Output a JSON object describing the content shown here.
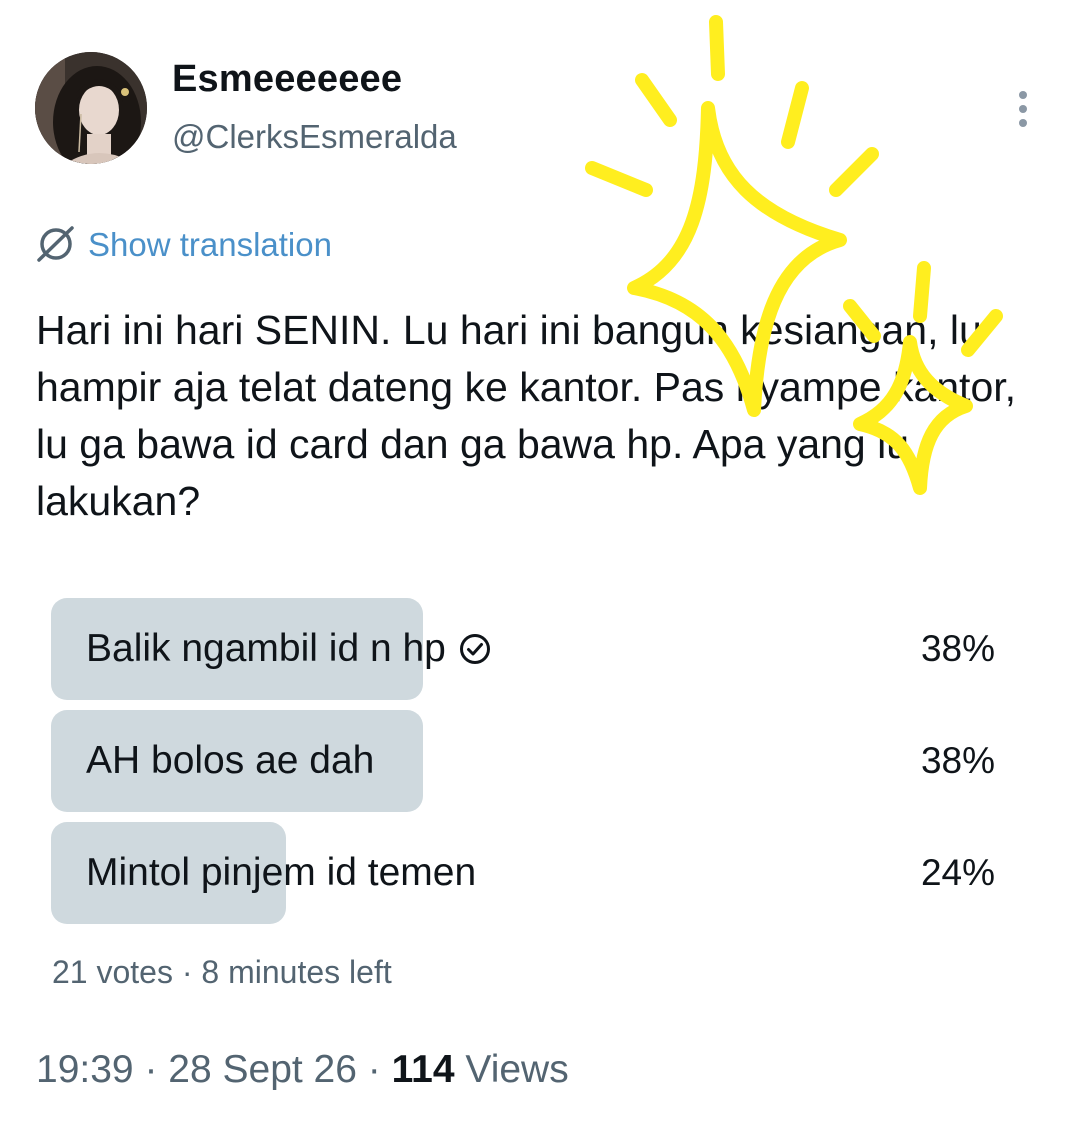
{
  "author": {
    "display_name": "Esmeeeeeee",
    "handle": "@ClerksEsmeralda",
    "avatar_icon": "profile-photo"
  },
  "translation": {
    "label": "Show translation",
    "icon": "globe-slash-icon",
    "color": "#4a90c9"
  },
  "tweet": {
    "text": "Hari ini hari SENIN. Lu hari ini bangun kesiangan, lu hampir aja telat dateng ke kantor. Pas nyampe kantor, lu ga bawa id card dan ga bawa hp. Apa yang lu lakukan?"
  },
  "poll": {
    "options": [
      {
        "label": "Balik ngambil id n hp",
        "percent": "38%",
        "share": 0.38,
        "selected": true
      },
      {
        "label": "AH bolos ae dah",
        "percent": "38%",
        "share": 0.38,
        "selected": false
      },
      {
        "label": "Mintol pinjem id temen",
        "percent": "24%",
        "share": 0.24,
        "selected": false
      }
    ],
    "votes": "21 votes",
    "time_left": "8 minutes left",
    "bar_color": "#cfd9de"
  },
  "meta": {
    "time": "19:39",
    "date": "28 Sept 26",
    "views_count": "114",
    "views_label": "Views"
  },
  "overlay": {
    "sparkle_color": "#ffee1f"
  }
}
